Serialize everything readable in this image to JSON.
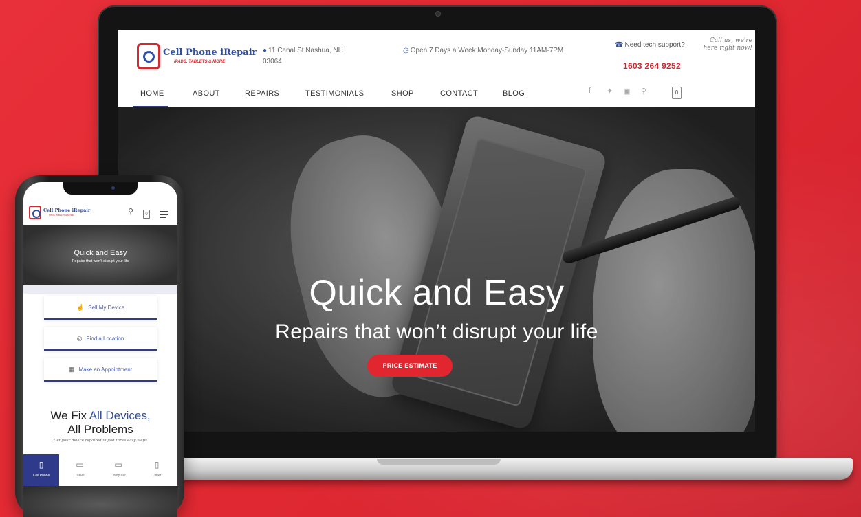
{
  "laptop": {
    "logo": {
      "name": "Cell Phone iRepair",
      "tagline": "iPADS, TABLETS & MORE"
    },
    "header": {
      "address": "11 Canal St Nashua, NH 03064",
      "hours": "Open 7 Days a Week Monday-Sunday 11AM-7PM",
      "support": "Need tech support?",
      "phone": "1603 264 9252",
      "call_note": "Call us, we're here right now!"
    },
    "nav": [
      "HOME",
      "ABOUT",
      "REPAIRS",
      "TESTIMONIALS",
      "SHOP",
      "CONTACT",
      "BLOG"
    ],
    "social_icons": [
      "facebook-icon",
      "twitter-icon",
      "instagram-icon",
      "search-icon"
    ],
    "cart_count": "0",
    "hero": {
      "title": "Quick and Easy",
      "subtitle": "Repairs that won’t disrupt your life",
      "button": "PRICE ESTIMATE"
    }
  },
  "phone": {
    "logo": {
      "name": "Cell Phone iRepair",
      "tagline": "iPADS, TABLETS & MORE"
    },
    "cart_count": "0",
    "hero": {
      "title": "Quick and Easy",
      "subtitle": "Repairs that won’t disrupt your life"
    },
    "cards": [
      "Sell My Device",
      "Find a Location",
      "Make an Appointment"
    ],
    "fix": {
      "line1_prefix": "We Fix ",
      "line1_highlight": "All Devices,",
      "line2": "All Problems",
      "sub": "Get your device repaired in just three easy steps"
    },
    "tabs": [
      "Cell Phone",
      "Tablet",
      "Computer",
      "Other"
    ]
  },
  "colors": {
    "brand_red": "#e1262f",
    "brand_blue": "#2f4fa2",
    "nav_active": "#2f3a8a",
    "background": "#e42a33"
  }
}
